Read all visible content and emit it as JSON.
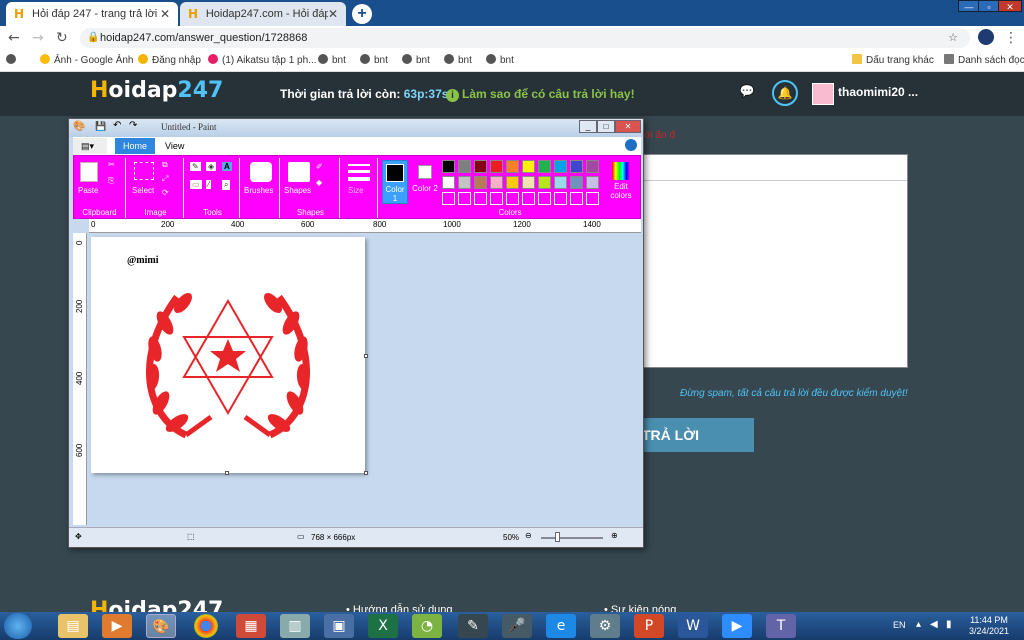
{
  "browser": {
    "tabs": [
      {
        "title": "Hỏi đáp 247 - trang trả lời",
        "active": true
      },
      {
        "title": "Hoidap247.com - Hỏi đáp online",
        "active": false
      }
    ],
    "url": "hoidap247.com/answer_question/1728868",
    "bookmarks": [
      "Ảnh - Google Ảnh",
      "Đăng nhập",
      "(1) Aikatsu tập 1 ph...",
      "bnt",
      "bnt",
      "bnt",
      "bnt",
      "bnt"
    ],
    "bookmarks_right": [
      "Dấu trang khác",
      "Danh sách đọc"
    ]
  },
  "site": {
    "logo": {
      "h": "H",
      "rest": "oidap",
      "num": "247"
    },
    "timer_label": "Thời gian trả lời còn:",
    "timer_value": "63p:37s",
    "howto": "Làm sao để có câu trả lời hay!",
    "username": "thaomimi20 ...",
    "spam_note": "Đừng spam, tất cả câu trả lời đều được kiểm duyệt!",
    "submit": "TRẢ LỜI",
    "red_hint": "ời ăn đ",
    "footer_logo": {
      "h": "H",
      "rest": "oidap247"
    },
    "footer_links": [
      "Hướng dẫn sử dụng",
      "Sự kiện nóng"
    ]
  },
  "paint": {
    "title": "Untitled - Paint",
    "tabs": [
      "Home",
      "View"
    ],
    "groups": {
      "clipboard": "Clipboard",
      "image": "Image",
      "tools": "Tools",
      "shapes": "Shapes",
      "colors": "Colors"
    },
    "buttons": {
      "paste": "Paste",
      "select": "Select",
      "brushes": "Brushes",
      "shapes": "Shapes",
      "size": "Size",
      "color1": "Color 1",
      "color2": "Color 2",
      "edit_colors": "Edit colors"
    },
    "ruler_h": [
      "0",
      "200",
      "400",
      "600",
      "800",
      "1000",
      "1200",
      "1400"
    ],
    "ruler_v": [
      "0",
      "200",
      "400",
      "600"
    ],
    "signature": "@mimi",
    "canvas_size": "768 × 666px",
    "zoom": "50%",
    "palette_row1": [
      "#000000",
      "#7f7f7f",
      "#880015",
      "#ed1c24",
      "#ff7f27",
      "#fff200",
      "#22b14c",
      "#00a2e8",
      "#3f48cc",
      "#a349a4"
    ],
    "palette_row2": [
      "#ffffff",
      "#c3c3c3",
      "#b97a57",
      "#ffaec9",
      "#ffc90e",
      "#efe4b0",
      "#b5e61d",
      "#99d9ea",
      "#7092be",
      "#c8bfe7"
    ],
    "drawing_color": "#e8262a"
  },
  "taskbar": {
    "lang": "EN",
    "time": "11:44 PM",
    "date": "3/24/2021"
  }
}
